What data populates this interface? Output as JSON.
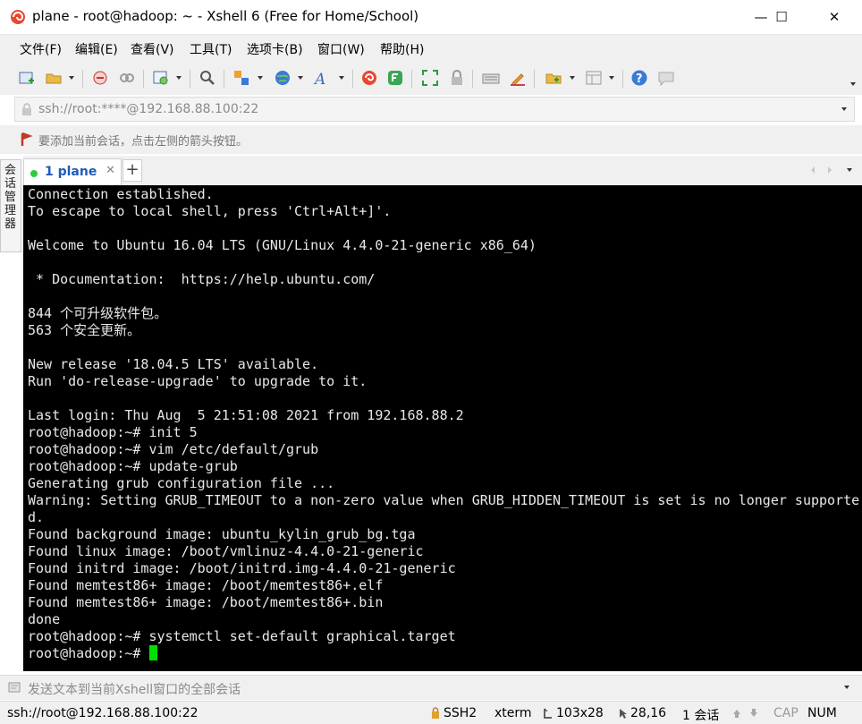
{
  "window": {
    "title": "plane - root@hadoop: ~ - Xshell 6 (Free for Home/School)",
    "minimize_glyph": "—",
    "maximize_glyph": "☐",
    "close_glyph": "✕"
  },
  "menu": {
    "items": [
      "文件(F)",
      "编辑(E)",
      "查看(V)",
      "工具(T)",
      "选项卡(B)",
      "窗口(W)",
      "帮助(H)"
    ]
  },
  "toolbar": {
    "icons": [
      "new-session-icon",
      "open-folder-icon",
      "disconnect-icon",
      "reconnect-icon",
      "properties-icon",
      "find-icon",
      "transfer-icon",
      "globe-icon",
      "font-icon",
      "xshell-icon",
      "xftp-icon",
      "fullscreen-icon",
      "lock-icon",
      "keyboard-icon",
      "highlight-icon",
      "compose-icon",
      "layout-icon",
      "help-icon",
      "chat-icon"
    ]
  },
  "address": {
    "value": "ssh://root:****@192.168.88.100:22"
  },
  "hint": {
    "text": "要添加当前会话，点击左侧的箭头按钮。"
  },
  "side": {
    "label": "会话管理器"
  },
  "tabs": [
    {
      "label": "1 plane",
      "close": "✕"
    }
  ],
  "tab_add": "+",
  "terminal": {
    "lines": [
      "Connection established.",
      "To escape to local shell, press 'Ctrl+Alt+]'.",
      "",
      "Welcome to Ubuntu 16.04 LTS (GNU/Linux 4.4.0-21-generic x86_64)",
      "",
      " * Documentation:  https://help.ubuntu.com/",
      "",
      "844 个可升级软件包。",
      "563 个安全更新。",
      "",
      "New release '18.04.5 LTS' available.",
      "Run 'do-release-upgrade' to upgrade to it.",
      "",
      "Last login: Thu Aug  5 21:51:08 2021 from 192.168.88.2",
      "root@hadoop:~# init 5",
      "root@hadoop:~# vim /etc/default/grub",
      "root@hadoop:~# update-grub",
      "Generating grub configuration file ...",
      "Warning: Setting GRUB_TIMEOUT to a non-zero value when GRUB_HIDDEN_TIMEOUT is set is no longer supporte",
      "d.",
      "Found background image: ubuntu_kylin_grub_bg.tga",
      "Found linux image: /boot/vmlinuz-4.4.0-21-generic",
      "Found initrd image: /boot/initrd.img-4.4.0-21-generic",
      "Found memtest86+ image: /boot/memtest86+.elf",
      "Found memtest86+ image: /boot/memtest86+.bin",
      "done",
      "root@hadoop:~# systemctl set-default graphical.target",
      "root@hadoop:~# "
    ],
    "background": "#000000",
    "foreground": "#e8e8e8",
    "cursor_color": "#00e000"
  },
  "send_bar": {
    "placeholder": "发送文本到当前Xshell窗口的全部会话"
  },
  "status": {
    "connection": "ssh://root@192.168.88.100:22",
    "protocol": "SSH2",
    "terminal_type": "xterm",
    "size": "103x28",
    "cursor_pos": "28,16",
    "sessions": "1 会话",
    "cap": "CAP",
    "num": "NUM"
  },
  "colors": {
    "accent": "#1e5bb8",
    "tab_active_dot": "#2ecc40"
  }
}
